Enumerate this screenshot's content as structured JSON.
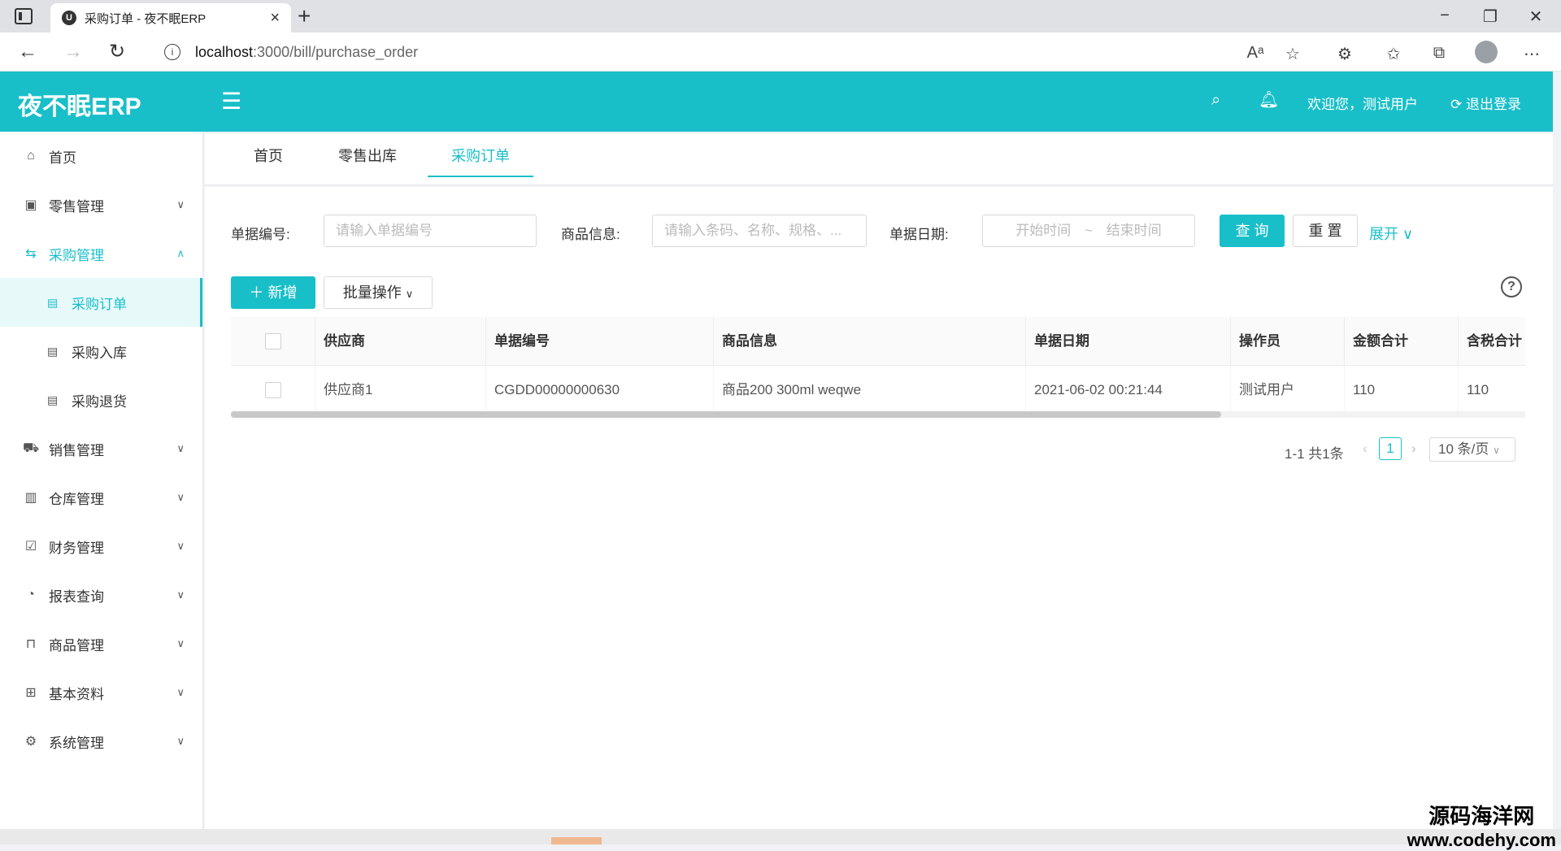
{
  "browser": {
    "tab_title": "采购订单 - 夜不眠ERP",
    "favicon_letter": "U",
    "url_host": "localhost",
    "url_rest": ":3000/bill/purchase_order"
  },
  "header": {
    "logo": "夜不眠ERP",
    "welcome": "欢迎您，测试用户",
    "logout": "退出登录"
  },
  "sidebar": {
    "items": [
      {
        "label": "首页"
      },
      {
        "label": "零售管理"
      },
      {
        "label": "采购管理"
      },
      {
        "label": "销售管理"
      },
      {
        "label": "仓库管理"
      },
      {
        "label": "财务管理"
      },
      {
        "label": "报表查询"
      },
      {
        "label": "商品管理"
      },
      {
        "label": "基本资料"
      },
      {
        "label": "系统管理"
      }
    ],
    "purchase_sub": [
      {
        "label": "采购订单"
      },
      {
        "label": "采购入库"
      },
      {
        "label": "采购退货"
      }
    ]
  },
  "page_tabs": [
    "首页",
    "零售出库",
    "采购订单"
  ],
  "filters": {
    "bill_no_label": "单据编号:",
    "bill_no_placeholder": "请输入单据编号",
    "goods_label": "商品信息:",
    "goods_placeholder": "请输入条码、名称、规格、...",
    "date_label": "单据日期:",
    "date_start": "开始时间",
    "date_sep": "~",
    "date_end": "结束时间",
    "query": "查 询",
    "reset": "重 置",
    "expand": "展开"
  },
  "toolbar": {
    "add": "新增",
    "batch": "批量操作"
  },
  "table": {
    "columns": [
      "供应商",
      "单据编号",
      "商品信息",
      "单据日期",
      "操作员",
      "金额合计",
      "含税合计"
    ],
    "rows": [
      [
        "供应商1",
        "CGDD00000000630",
        "商品200 300ml weqwe",
        "2021-06-02 00:21:44",
        "测试用户",
        "110",
        "110"
      ]
    ]
  },
  "pagination": {
    "total": "1-1 共1条",
    "current": "1",
    "page_size": "10 条/页"
  },
  "watermark": {
    "cn": "源码海洋网",
    "url": "www.codehy.com"
  },
  "colors": {
    "accent": "#19bfc8"
  }
}
